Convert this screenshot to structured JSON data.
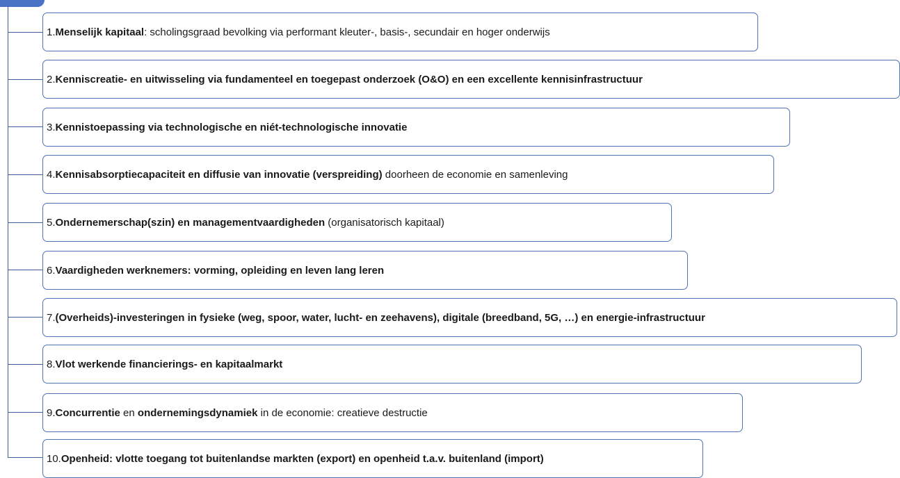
{
  "items": [
    {
      "num": "1.",
      "segments": [
        {
          "text": " "
        },
        {
          "text": "Menselijk kapitaal",
          "bold": true
        },
        {
          "text": ": scholingsgraad bevolking via performant kleuter-, basis-, secundair en hoger onderwijs"
        }
      ]
    },
    {
      "num": "2.",
      "segments": [
        {
          "text": " "
        },
        {
          "text": "Kenniscreatie- en uitwisseling via fundamenteel en toegepast onderzoek (O&O) en een excellente kennisinfrastructuur",
          "bold": true
        }
      ]
    },
    {
      "num": "3.",
      "segments": [
        {
          "text": " "
        },
        {
          "text": "Kennistoepassing via technologische en niét-technologische innovatie",
          "bold": true
        }
      ]
    },
    {
      "num": "4.",
      "segments": [
        {
          "text": " "
        },
        {
          "text": "Kennisabsorptiecapaciteit en diffusie van innovatie (verspreiding)",
          "bold": true
        },
        {
          "text": " doorheen de economie en samenleving"
        }
      ]
    },
    {
      "num": "5.",
      "segments": [
        {
          "text": " "
        },
        {
          "text": "Ondernemerschap(szin) en managementvaardigheden",
          "bold": true
        },
        {
          "text": " (organisatorisch kapitaal)"
        }
      ]
    },
    {
      "num": "6.",
      "segments": [
        {
          "text": " "
        },
        {
          "text": "Vaardigheden werknemers: vorming, opleiding en leven lang leren",
          "bold": true
        }
      ]
    },
    {
      "num": "7.",
      "segments": [
        {
          "text": " "
        },
        {
          "text": "(Overheids)-investeringen in fysieke (weg, spoor, water, lucht- en zeehavens), digitale (breedband, 5G, …) en energie-infrastructuur",
          "bold": true
        }
      ]
    },
    {
      "num": "8.",
      "segments": [
        {
          "text": " "
        },
        {
          "text": "Vlot werkende financierings- en kapitaalmarkt",
          "bold": true
        }
      ]
    },
    {
      "num": "9.",
      "segments": [
        {
          "text": " "
        },
        {
          "text": "Concurrentie",
          "bold": true
        },
        {
          "text": " en "
        },
        {
          "text": "ondernemingsdynamiek",
          "bold": true
        },
        {
          "text": " in de economie: creatieve destructie"
        }
      ]
    },
    {
      "num": "10.",
      "segments": [
        {
          "text": " "
        },
        {
          "text": "Openheid: vlotte toegang tot buitenlandse markten (export) en openheid t.a.v. buitenland (import)",
          "bold": true
        }
      ]
    }
  ],
  "colors": {
    "box_border": "#4f73b6",
    "connector": "#3e5f9c",
    "header_tab": "#4a72c4"
  }
}
